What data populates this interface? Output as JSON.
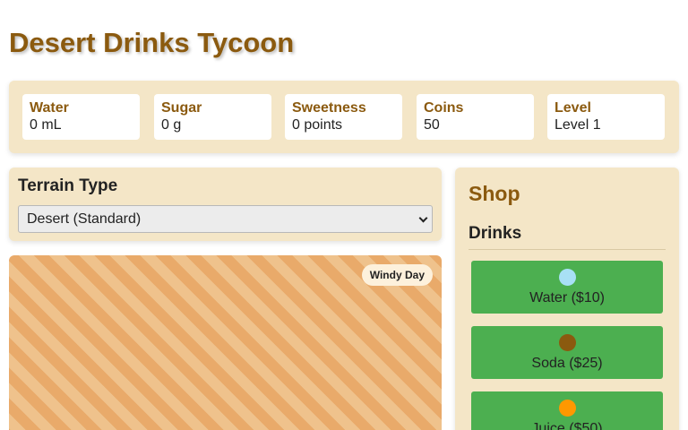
{
  "app": {
    "title": "Desert Drinks Tycoon"
  },
  "stats": [
    {
      "label": "Water",
      "value": "0 mL"
    },
    {
      "label": "Sugar",
      "value": "0 g"
    },
    {
      "label": "Sweetness",
      "value": "0 points"
    },
    {
      "label": "Coins",
      "value": "50"
    },
    {
      "label": "Level",
      "value": "Level 1"
    }
  ],
  "terrain": {
    "heading": "Terrain Type",
    "selected": "Desert (Standard)"
  },
  "game": {
    "weather": "Windy Day"
  },
  "shop": {
    "title": "Shop",
    "section": "Drinks",
    "drinks": [
      {
        "label": "Water ($10)",
        "color": "#a8e0f5"
      },
      {
        "label": "Soda ($25)",
        "color": "#8b5a0f"
      },
      {
        "label": "Juice ($50)",
        "color": "#ff9800"
      }
    ]
  },
  "colors": {
    "accent": "#8b5a0f",
    "panel": "#f4e6c7",
    "button": "#4caf50"
  }
}
